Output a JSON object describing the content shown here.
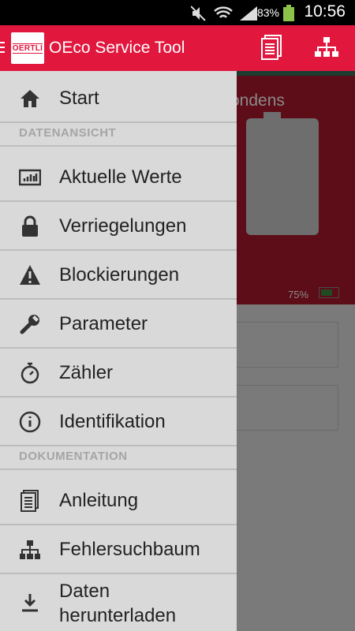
{
  "status_bar": {
    "battery": "83%",
    "time": "10:56"
  },
  "app_bar": {
    "logo_text": "OERTLI",
    "title": "OEco Service Tool"
  },
  "background": {
    "device_title": "ondens",
    "battery_level": "75%"
  },
  "drawer": {
    "start": "Start",
    "section_data": "DATENANSICHT",
    "items_data": [
      "Aktuelle Werte",
      "Verriegelungen",
      "Blockierungen",
      "Parameter",
      "Zähler",
      "Identifikation"
    ],
    "section_doc": "DOKUMENTATION",
    "items_doc": [
      "Anleitung",
      "Fehlersuchbaum",
      "Daten\nherunterladen"
    ]
  }
}
